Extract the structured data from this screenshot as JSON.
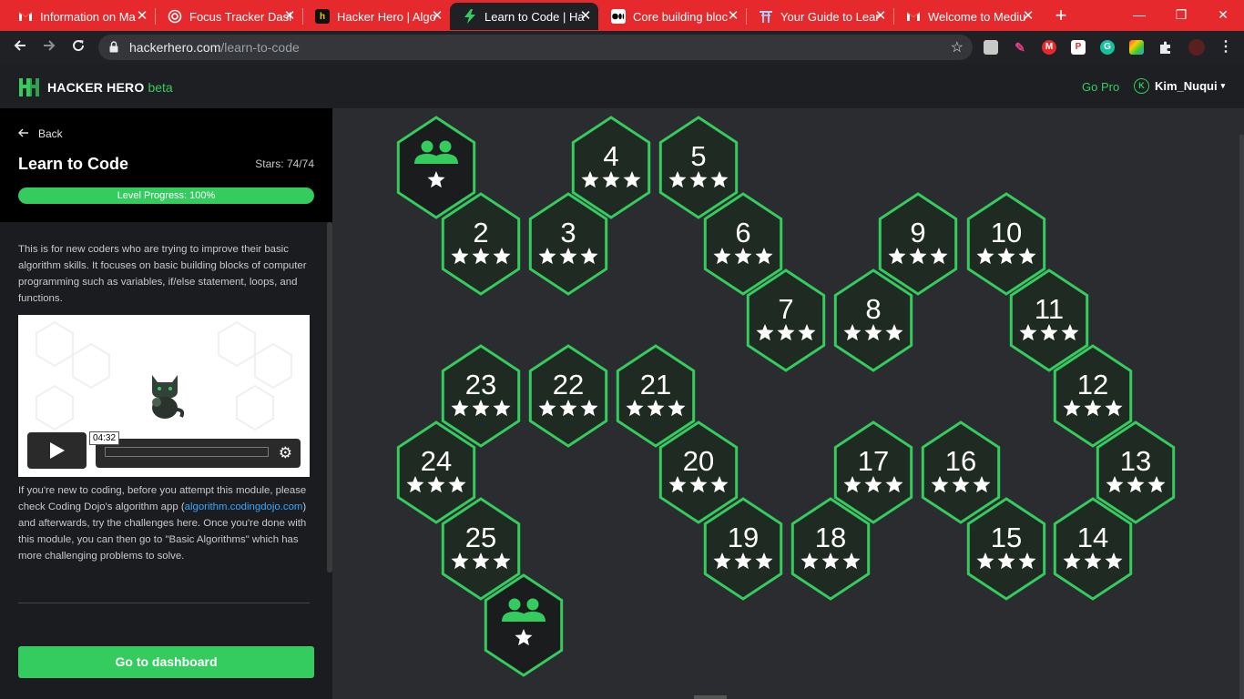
{
  "browser": {
    "tabs": [
      {
        "label": "Information on Ma",
        "favicon": "gmail-icon",
        "color": "#ffffff"
      },
      {
        "label": "Focus Tracker Dash",
        "favicon": "circle-target-icon",
        "color": "#ffffff"
      },
      {
        "label": "Hacker Hero | Algo",
        "favicon": "hacker-hero-icon",
        "color": "#ffffff"
      },
      {
        "label": "Learn to Code | Ha",
        "favicon": "bolt-icon",
        "color": "#ffffff"
      },
      {
        "label": "Core building bloc",
        "favicon": "medium-icon",
        "color": "#ffffff"
      },
      {
        "label": "Your Guide to Lear",
        "favicon": "torii-icon",
        "color": "#ffffff"
      },
      {
        "label": "Welcome to Mediu",
        "favicon": "gmail-icon",
        "color": "#ffffff"
      }
    ],
    "active_tab": 3,
    "url_host": "hackerhero.com",
    "url_path": "/learn-to-code",
    "tab_close": "✕",
    "new_tab": "+",
    "win_minimize": "—",
    "win_restore": "❐",
    "win_close": "✕",
    "star": "☆"
  },
  "header": {
    "logo_text": "HACKER HERO",
    "logo_beta": "beta",
    "go_pro": "Go Pro",
    "user_initial": "K",
    "username": "Kim_Nuqui",
    "caret": "▾"
  },
  "sidebar": {
    "back_label": "Back",
    "title": "Learn to Code",
    "stars": "Stars: 74/74",
    "progress_label": "Level Progress: 100%",
    "progress_fraction": 1.0,
    "description": "This is for new coders who are trying to improve their basic algorithm skills. It focuses on basic building blocks of computer programming such as variables, if/else statement, loops, and functions.",
    "video_time": "04:32",
    "note_before_link": "If you're new to coding, before you attempt this module, please check Coding Dojo's algorithm app (",
    "note_link": "algorithm.codingdojo.com",
    "note_after_link": ") and afterwards, try the challenges here. Once you're done with this module, you can then go to \"Basic Algorithms\" which has more challenging problems to solve.",
    "dashboard_button": "Go to dashboard"
  },
  "colors": {
    "accent": "#35cc5f",
    "hex_fill": "#1e2a22",
    "hex_stroke": "#35cc5f",
    "tab_bar": "#e5292c"
  },
  "map": {
    "hexes": [
      {
        "label": "",
        "kind": "group",
        "stars": 1
      },
      {
        "label": "2",
        "stars": 3
      },
      {
        "label": "3",
        "stars": 3
      },
      {
        "label": "4",
        "stars": 3
      },
      {
        "label": "5",
        "stars": 3
      },
      {
        "label": "6",
        "stars": 3
      },
      {
        "label": "7",
        "stars": 3
      },
      {
        "label": "8",
        "stars": 3
      },
      {
        "label": "9",
        "stars": 3
      },
      {
        "label": "10",
        "stars": 3
      },
      {
        "label": "11",
        "stars": 3
      },
      {
        "label": "12",
        "stars": 3
      },
      {
        "label": "13",
        "stars": 3
      },
      {
        "label": "14",
        "stars": 3
      },
      {
        "label": "15",
        "stars": 3
      },
      {
        "label": "16",
        "stars": 3
      },
      {
        "label": "17",
        "stars": 3
      },
      {
        "label": "18",
        "stars": 3
      },
      {
        "label": "19",
        "stars": 3
      },
      {
        "label": "20",
        "stars": 3
      },
      {
        "label": "21",
        "stars": 3
      },
      {
        "label": "22",
        "stars": 3
      },
      {
        "label": "23",
        "stars": 3
      },
      {
        "label": "24",
        "stars": 3
      },
      {
        "label": "25",
        "stars": 3
      },
      {
        "label": "",
        "kind": "group",
        "stars": 1
      }
    ]
  }
}
